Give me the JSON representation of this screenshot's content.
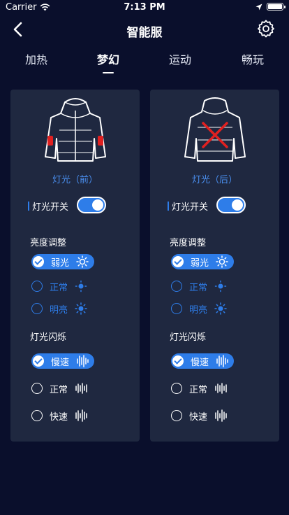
{
  "status": {
    "carrier": "Carrier",
    "time": "7:13 PM"
  },
  "nav": {
    "title": "智能服"
  },
  "tabs": [
    "加热",
    "梦幻",
    "运动",
    "畅玩"
  ],
  "active_tab": "梦幻",
  "cards": [
    {
      "title": "灯光（前）",
      "switch_label": "灯光开关",
      "switch_on": true,
      "brightness_title": "亮度调整",
      "brightness_options": [
        "弱光",
        "正常",
        "明亮"
      ],
      "brightness_selected": "弱光",
      "flash_title": "灯光闪烁",
      "flash_options": [
        "慢速",
        "正常",
        "快速"
      ],
      "flash_selected": "慢速"
    },
    {
      "title": "灯光（后）",
      "switch_label": "灯光开关",
      "switch_on": true,
      "brightness_title": "亮度调整",
      "brightness_options": [
        "弱光",
        "正常",
        "明亮"
      ],
      "brightness_selected": "弱光",
      "flash_title": "灯光闪烁",
      "flash_options": [
        "慢速",
        "正常",
        "快速"
      ],
      "flash_selected": "慢速"
    }
  ],
  "colors": {
    "background": "#0a0f2c",
    "card": "#1f2840",
    "accent": "#2e7de9",
    "light_red": "#e02020"
  }
}
